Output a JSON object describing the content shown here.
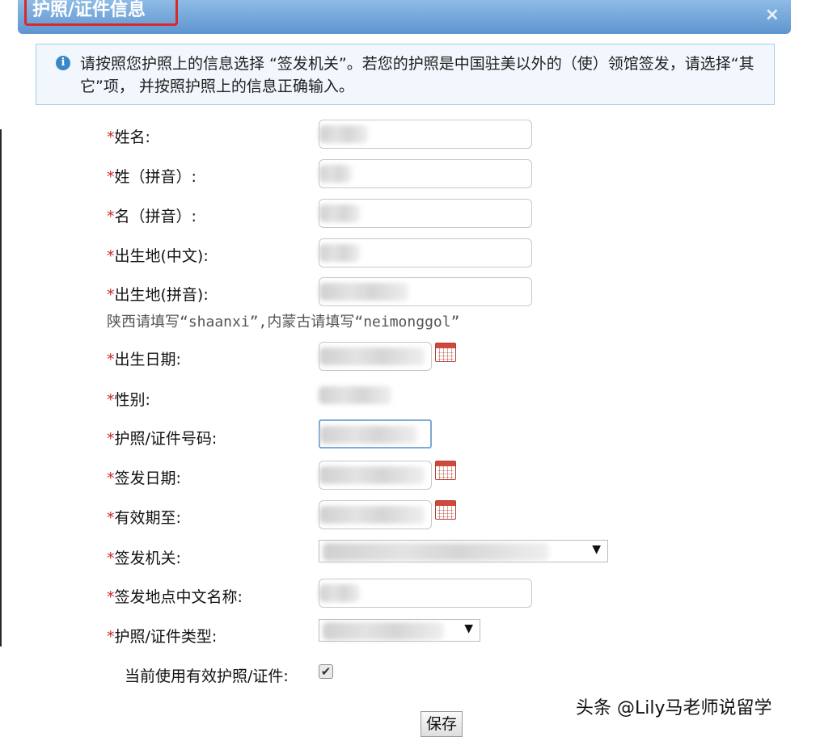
{
  "dialog": {
    "title": "护照/证件信息",
    "close_label": "×",
    "info_icon": "info-icon",
    "info_text": "请按照您护照上的信息选择 “签发机关”。若您的护照是中国驻美以外的（使）领馆签发，请选择“其它”项， 并按照护照上的信息正确输入。"
  },
  "form": {
    "required_mark": "*",
    "fields": [
      {
        "label": "姓名:"
      },
      {
        "label": "姓（拼音）:"
      },
      {
        "label": "名（拼音）:"
      },
      {
        "label": "出生地(中文):"
      },
      {
        "label": "出生地(拼音):"
      },
      {
        "label": "出生日期:"
      },
      {
        "label": "性别:"
      },
      {
        "label": "护照/证件号码:"
      },
      {
        "label": "签发日期:"
      },
      {
        "label": "有效期至:"
      },
      {
        "label": "签发机关:"
      },
      {
        "label": "签发地点中文名称:"
      },
      {
        "label": "护照/证件类型:"
      }
    ],
    "birthplace_hint": "陕西请填写“shaanxi”,内蒙古请填写“neimonggol”",
    "calendar_icon": "calendar-icon",
    "dropdown_arrow": "▼",
    "current_valid_label": "当前使用有效护照/证件:",
    "current_valid_checked": true,
    "checkbox_glyph": "✔",
    "save_label": "保存"
  },
  "watermark": "头条 @Lily马老师说留学",
  "colors": {
    "titlebar": "#6fa3d8",
    "required_mark": "#c42a20",
    "title_highlight": "#d52b2b",
    "info_bg": "#f1f7fc"
  }
}
